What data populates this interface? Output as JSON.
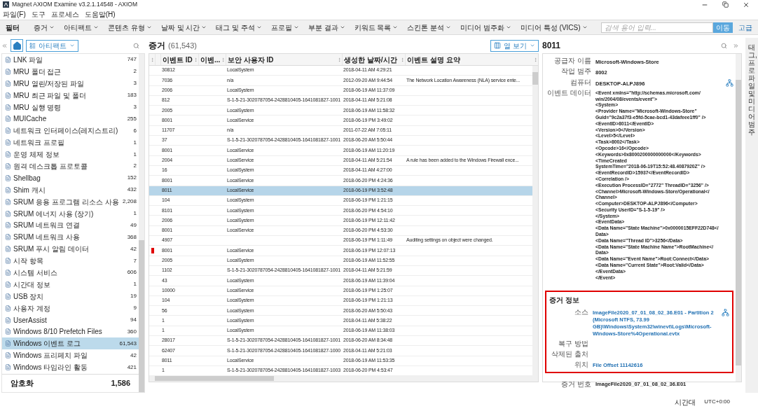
{
  "window": {
    "title": "Magnet AXIOM Examine v3.2.1.14548 - AXIOM"
  },
  "menu": [
    "파일(F)",
    "도구",
    "프로세스",
    "도움말(H)"
  ],
  "filter_bar": {
    "label": "필터",
    "filters": [
      "증거",
      "아티팩트",
      "콘텐츠 유형",
      "날짜 및 시간",
      "태그 및 주석",
      "프로필",
      "부분 결과",
      "키워드 목록",
      "스킨톤 분석",
      "미디어 범주화",
      "미디어 특성 (VICS)"
    ],
    "search": {
      "placeholder": "검색 용어 입력...",
      "button": "이동"
    },
    "advanced": "고급"
  },
  "sidebar": {
    "view": "아티팩트",
    "items": [
      {
        "name": "LNK 파일",
        "count": "747",
        "selected": false
      },
      {
        "name": "MRU 폴더 접근",
        "count": "2",
        "selected": false
      },
      {
        "name": "MRU 열린/저장된 파일",
        "count": "3",
        "selected": false
      },
      {
        "name": "MRU 최근 파일 및 폴더",
        "count": "183",
        "selected": false
      },
      {
        "name": "MRU 실행 명령",
        "count": "3",
        "selected": false
      },
      {
        "name": "MUICache",
        "count": "255",
        "selected": false
      },
      {
        "name": "네트워크 인터페이스(레지스트리)",
        "count": "6",
        "selected": false
      },
      {
        "name": "네트워크 프로필",
        "count": "1",
        "selected": false
      },
      {
        "name": "운영 체제 정보",
        "count": "1",
        "selected": false
      },
      {
        "name": "원격 데스크톱 프로토콜",
        "count": "2",
        "selected": false
      },
      {
        "name": "Shellbag",
        "count": "152",
        "selected": false
      },
      {
        "name": "Shim 캐시",
        "count": "432",
        "selected": false
      },
      {
        "name": "SRUM 응용 프로그램 리소스 사용",
        "count": "2,208",
        "selected": false
      },
      {
        "name": "SRUM 에너지 사용 (장기)",
        "count": "1",
        "selected": false
      },
      {
        "name": "SRUM 네트워크 연결",
        "count": "49",
        "selected": false
      },
      {
        "name": "SRUM 네트워크 사용",
        "count": "368",
        "selected": false
      },
      {
        "name": "SRUM 푸시 알림 데이터",
        "count": "42",
        "selected": false
      },
      {
        "name": "시작 항목",
        "count": "7",
        "selected": false
      },
      {
        "name": "시스템 서비스",
        "count": "606",
        "selected": false
      },
      {
        "name": "시간대 정보",
        "count": "1",
        "selected": false
      },
      {
        "name": "USB 장치",
        "count": "19",
        "selected": false
      },
      {
        "name": "사용자 계정",
        "count": "9",
        "selected": false
      },
      {
        "name": "UserAssist",
        "count": "94",
        "selected": false
      },
      {
        "name": "Windows 8/10 Prefetch Files",
        "count": "360",
        "selected": false
      },
      {
        "name": "Windows 이벤트 로그",
        "count": "61,543",
        "selected": true
      },
      {
        "name": "Windows 프리페치 파일",
        "count": "42",
        "selected": false
      },
      {
        "name": "Windows 타임라인 활동",
        "count": "421",
        "selected": false
      }
    ],
    "total": {
      "label": "암호화",
      "count": "1,586"
    }
  },
  "evidence": {
    "title": "증거",
    "count": "(61,543)",
    "view_button": "열 보기",
    "columns": [
      "이벤트 ID",
      "이벤...",
      "보안 사용자 ID",
      "생성한 날짜/시간",
      "이벤트 설명 요약"
    ],
    "rows": [
      {
        "event_id": "30812",
        "user_id": "LocalSystem",
        "created": "2018-04-11 AM 4:29:21",
        "selected": false,
        "flagged": false
      },
      {
        "event_id": "7036",
        "user_id": "n/a",
        "created": "2012-09-20 AM 9:44:54",
        "summary": "The Network Location Awareness (NLA) service ente...",
        "selected": false,
        "flagged": false
      },
      {
        "event_id": "2006",
        "user_id": "LocalSystem",
        "created": "2018-06-19 AM 11:37:09",
        "selected": false,
        "flagged": false
      },
      {
        "event_id": "812",
        "user_id": "S-1-5-21-3020787054-2428810405-1641081827-1001",
        "created": "2018-04-11 AM 5:21:08",
        "selected": false,
        "flagged": false
      },
      {
        "event_id": "2005",
        "user_id": "LocalSystem",
        "created": "2018-06-19 AM 11:58:32",
        "selected": false,
        "flagged": false
      },
      {
        "event_id": "8001",
        "user_id": "LocalService",
        "created": "2018-06-19 PM 3:49:02",
        "selected": false,
        "flagged": false
      },
      {
        "event_id": "11707",
        "user_id": "n/a",
        "created": "2011-07-22 AM 7:05:11",
        "selected": false,
        "flagged": false
      },
      {
        "event_id": "37",
        "user_id": "S-1-5-21-3020787054-2428810405-1641081827-1001",
        "created": "2018-06-20 AM 5:50:44",
        "selected": false,
        "flagged": false
      },
      {
        "event_id": "8001",
        "user_id": "LocalService",
        "created": "2018-06-19 AM 11:20:19",
        "selected": false,
        "flagged": false
      },
      {
        "event_id": "2004",
        "user_id": "LocalService",
        "created": "2018-04-11 AM 5:21:54",
        "summary": "A rule has been added to the Windows Firewall exce...",
        "selected": false,
        "flagged": false
      },
      {
        "event_id": "16",
        "user_id": "LocalSystem",
        "created": "2018-04-11 AM 4:27:00",
        "selected": false,
        "flagged": false
      },
      {
        "event_id": "8001",
        "user_id": "LocalService",
        "created": "2018-06-20 PM 4:24:36",
        "selected": false,
        "flagged": false
      },
      {
        "event_id": "8011",
        "user_id": "LocalService",
        "created": "2018-06-19 PM 3:52:48",
        "selected": true,
        "flagged": false
      },
      {
        "event_id": "104",
        "user_id": "LocalSystem",
        "created": "2018-06-19 PM 1:21:15",
        "selected": false,
        "flagged": false
      },
      {
        "event_id": "8101",
        "user_id": "LocalSystem",
        "created": "2018-06-20 PM 4:54:10",
        "selected": false,
        "flagged": false
      },
      {
        "event_id": "2006",
        "user_id": "LocalSystem",
        "created": "2018-06-19 PM 12:11:42",
        "selected": false,
        "flagged": false
      },
      {
        "event_id": "8001",
        "user_id": "LocalService",
        "created": "2018-06-20 PM 4:53:30",
        "selected": false,
        "flagged": false
      },
      {
        "event_id": "4907",
        "created": "2018-06-19 PM 1:11:49",
        "summary": "Auditing settings on object were changed.",
        "selected": false,
        "flagged": false
      },
      {
        "event_id": "8001",
        "user_id": "LocalService",
        "created": "2018-06-19 PM 12:07:13",
        "selected": false,
        "flagged": true
      },
      {
        "event_id": "2005",
        "user_id": "LocalSystem",
        "created": "2018-06-19 AM 11:52:55",
        "selected": false,
        "flagged": false
      },
      {
        "event_id": "1102",
        "user_id": "S-1-5-21-3020787054-2428810405-1641081827-1001",
        "created": "2018-04-11 AM 5:21:59",
        "selected": false,
        "flagged": false
      },
      {
        "event_id": "43",
        "user_id": "LocalSystem",
        "created": "2018-06-19 AM 11:39:04",
        "selected": false,
        "flagged": false
      },
      {
        "event_id": "10000",
        "user_id": "LocalService",
        "created": "2018-06-19 PM 1:25:07",
        "selected": false,
        "flagged": false
      },
      {
        "event_id": "104",
        "user_id": "LocalSystem",
        "created": "2018-06-19 PM 1:21:13",
        "selected": false,
        "flagged": false
      },
      {
        "event_id": "56",
        "user_id": "LocalSystem",
        "created": "2018-06-20 AM 5:50:43",
        "selected": false,
        "flagged": false
      },
      {
        "event_id": "1",
        "user_id": "LocalSystem",
        "created": "2018-04-11 AM 5:38:22",
        "selected": false,
        "flagged": false
      },
      {
        "event_id": "1",
        "user_id": "LocalSystem",
        "created": "2018-06-19 AM 11:38:03",
        "selected": false,
        "flagged": false
      },
      {
        "event_id": "28017",
        "user_id": "S-1-5-21-3020787054-2428810405-1641081827-1001",
        "created": "2018-06-20 AM 8:34:48",
        "selected": false,
        "flagged": false
      },
      {
        "event_id": "62407",
        "user_id": "S-1-5-21-3020787054-2428810405-1641081827-1000",
        "created": "2018-04-11 AM 5:21:03",
        "selected": false,
        "flagged": false
      },
      {
        "event_id": "8011",
        "user_id": "LocalService",
        "created": "2018-06-19 AM 11:53:35",
        "selected": false,
        "flagged": false
      },
      {
        "event_id": "1",
        "user_id": "S-1-5-21-3020787054-2428810405-1641081827-1003",
        "created": "2018-06-20 PM 4:53:47",
        "selected": false,
        "flagged": false
      }
    ]
  },
  "details": {
    "title": "8011",
    "fields": [
      {
        "label": "공급자 이름",
        "value": "Microsoft-Windows-Store",
        "action_icon": false
      },
      {
        "label": "작업 범주",
        "value": "8002",
        "action_icon": false
      },
      {
        "label": "컴퓨터",
        "value": "DESKTOP-ALPJ896",
        "action_icon": true
      },
      {
        "label": "이벤트 데이터",
        "value": "<Event xmlns=\"http://schemas.microsoft.com/\nwin/2004/08/events/event\">\n<System>\n<Provider Name=\"Microsoft-Windows-Store\"\nGuid=\"9c2a37f3-e5fd-5cae-bcd1-43dafeee1ff0\" />\n<EventID>8011</EventID>\n<Version>0</Version>\n<Level>5</Level>\n<Task>8002</Task>\n<Opcode>16</Opcode>\n<Keywords>0x8000200000000000</Keywords>\n<TimeCreated\nSystemTime=\"2018-06-19T15:52:48.4087920Z\" />\n<EventRecordID>15937</EventRecordID>\n<Correlation />\n<Execution ProcessID=\"2772\" ThreadID=\"3256\" />\n<Channel>Microsoft-Windows-Store/Operational</\nChannel>\n<Computer>DESKTOP-ALPJ896</Computer>\n<Security UserID=\"S-1-5-19\" />\n</System>\n<EventData>\n<Data Name=\"State Machine\">0x0000015EFF22D748</\nData>\n<Data Name=\"Thread ID\">3256</Data>\n<Data Name=\"State Machine Name\">RootMachine</\nData>\n<Data Name=\"Event Name\">Root:Connect</Data>\n<Data Name=\"Current State\">Root:Valid</Data>\n</EventData>\n</Event>",
        "action_icon": false
      }
    ],
    "evidence_info": {
      "title": "증거 정보",
      "fields": [
        {
          "label": "소스",
          "value": "ImageFile2020_07_01_08_02_36.E01 - Partition 2 (Microsoft NTFS, 73.99 GB)\\Windows\\System32\\winevt\\Logs\\Microsoft-Windows-Store%4Operational.evtx",
          "kind": "link",
          "action_icon": true
        },
        {
          "label": "복구 방법",
          "action_icon": false
        },
        {
          "label": "삭제된 출처",
          "action_icon": false
        },
        {
          "label": "위치",
          "value": "File Offset 11142616",
          "kind": "link",
          "action_icon": false
        }
      ]
    },
    "evidence_number": {
      "label": "증거 번호",
      "value": "ImageFile2020_07_01_08_02_36.E01"
    }
  },
  "side_tab": "태그, 프로파일 및 미디어 범주",
  "status_bar": {
    "label": "시간대",
    "value": "UTC+0:00"
  }
}
